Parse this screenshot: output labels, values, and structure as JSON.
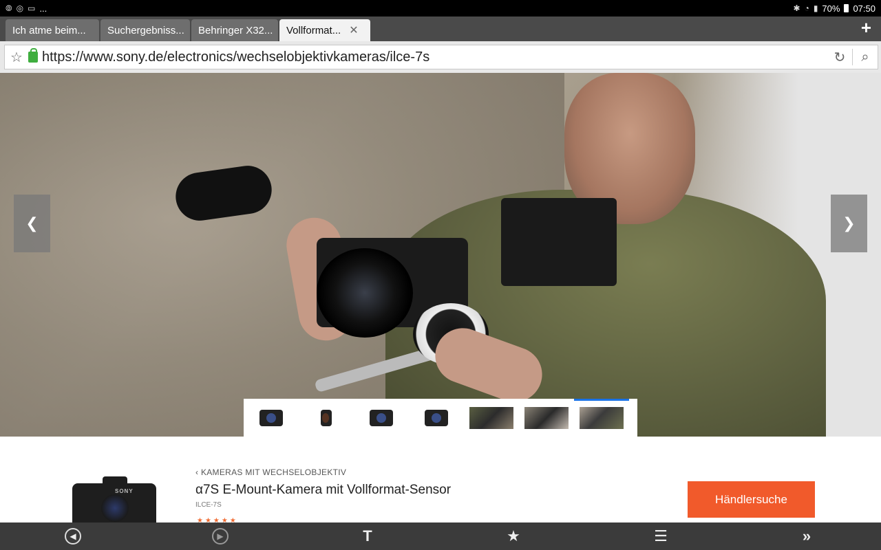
{
  "status_bar": {
    "left_icons": [
      "cast-icon",
      "sync-icon",
      "app-icon"
    ],
    "more": "...",
    "battery": "70%",
    "time": "07:50"
  },
  "tabs": [
    {
      "title": "Ich atme beim..."
    },
    {
      "title": "Suchergebniss..."
    },
    {
      "title": "Behringer X32..."
    },
    {
      "title": "Vollformat...",
      "active": true
    }
  ],
  "url_bar": {
    "url": "https://www.sony.de/electronics/wechselobjektivkameras/ilce-7s"
  },
  "carousel": {
    "thumbnail_count": 7,
    "selected_index": 6
  },
  "product": {
    "breadcrumb": "KAMERAS MIT WECHSELOBJEKTIV",
    "title": "α7S E-Mount-Kamera mit Vollformat-Sensor",
    "model": "ILCE-7S",
    "brand_on_image": "SONY",
    "dealer_button": "Händlersuche",
    "accent_color": "#f15a2b"
  },
  "bottom_bar": {
    "icons": [
      "back-icon",
      "forward-icon",
      "text-size-icon",
      "bookmark-star-icon",
      "list-menu-icon",
      "more-chevrons-icon"
    ]
  }
}
